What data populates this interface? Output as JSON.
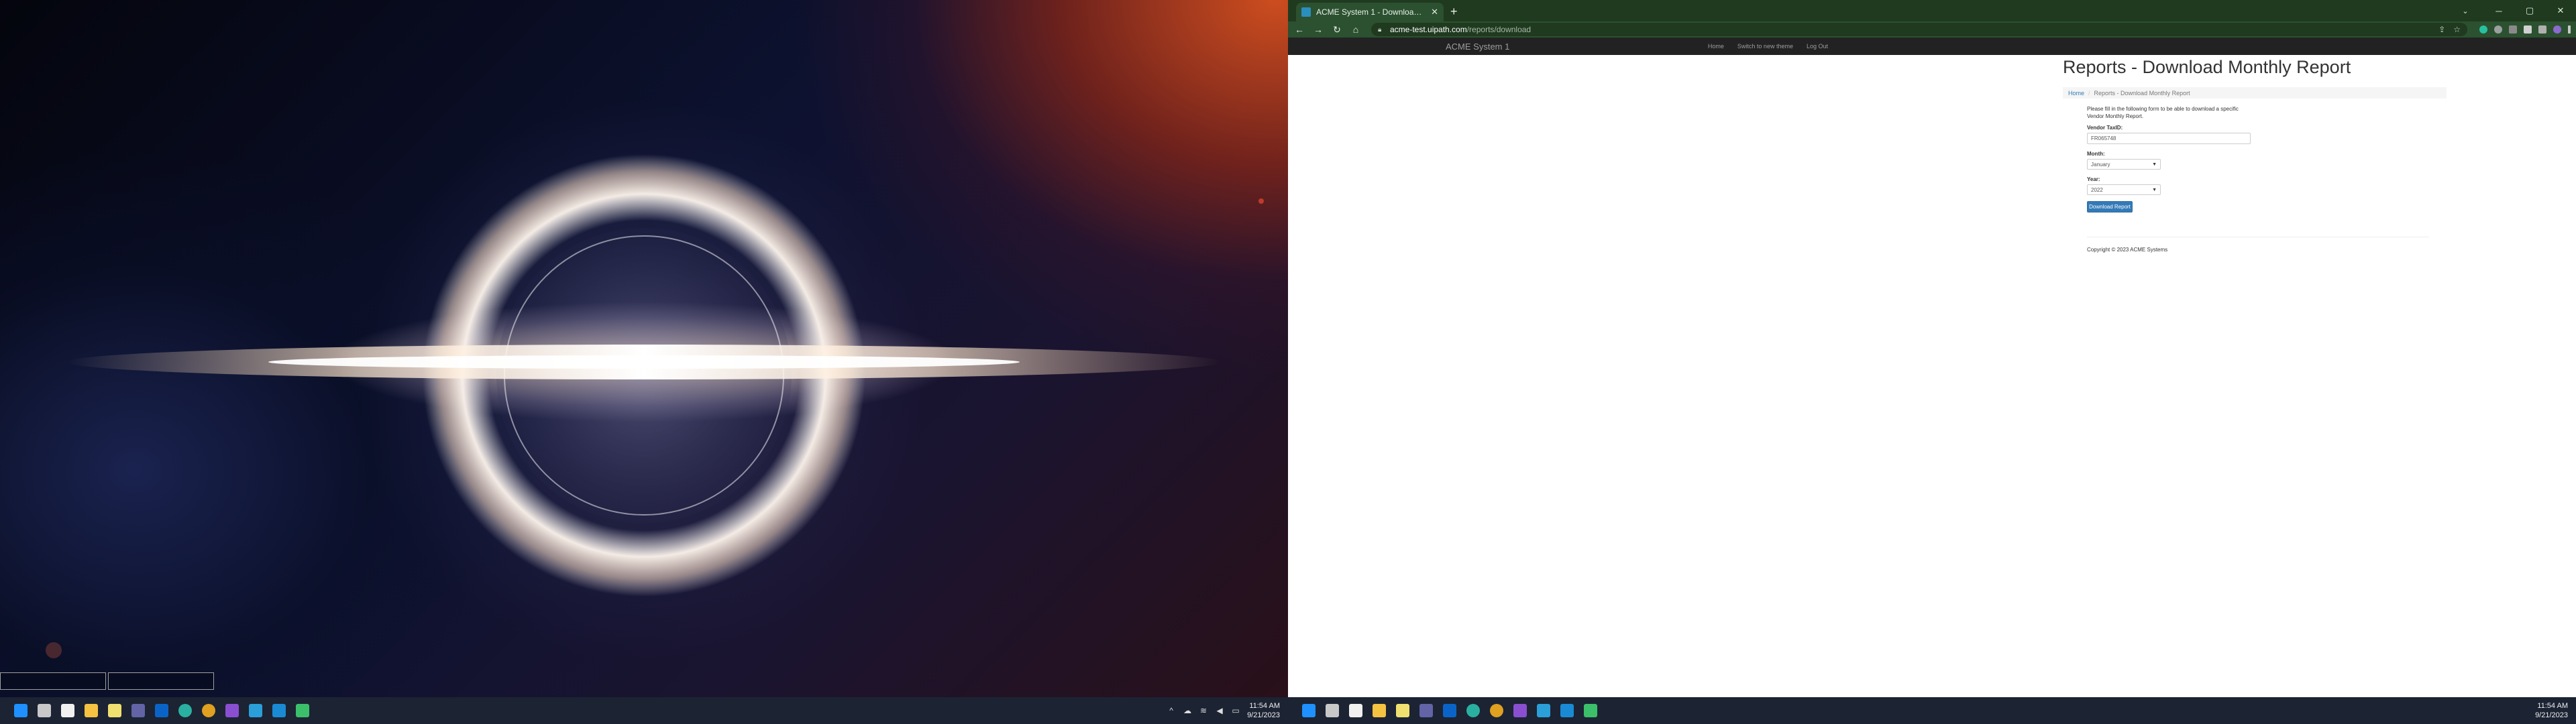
{
  "left_screen": {
    "wallpaper": "black-hole",
    "taskbar": {
      "icons": [
        "windows-start",
        "file-explorer-small",
        "calendar",
        "file-explorer",
        "notepad",
        "teams",
        "outlook",
        "edge-canary",
        "chrome",
        "visual-studio",
        "uipath-studio",
        "vscode",
        "uipath-assistant"
      ],
      "tray_time": "11:54 AM",
      "tray_date": "9/21/2023"
    }
  },
  "browser": {
    "tab": {
      "title": "ACME System 1 - Download M..."
    },
    "url": {
      "host": "acme-test.uipath.com",
      "path": "/reports/download"
    },
    "window_controls": {
      "minimize": "─",
      "maximize": "▢",
      "close": "✕"
    }
  },
  "site": {
    "brand": "ACME System 1",
    "nav": {
      "home": "Home",
      "theme": "Switch to new theme",
      "logout": "Log Out"
    },
    "page_title": "Reports - Download Monthly Report",
    "breadcrumb": {
      "home": "Home",
      "current": "Reports - Download Monthly Report"
    },
    "form": {
      "intro": "Please fill in the following form to be able to download a specific Vendor Monthly Report.",
      "vendor_label": "Vendor TaxID:",
      "vendor_value": "FR065748",
      "month_label": "Month:",
      "month_value": "January",
      "year_label": "Year:",
      "year_value": "2022",
      "submit": "Download Report"
    },
    "copyright": "Copyright © 2023 ACME Systems"
  },
  "right_screen": {
    "taskbar": {
      "icons": [
        "windows-start",
        "file-explorer-small",
        "calendar",
        "file-explorer",
        "notepad",
        "teams",
        "outlook",
        "edge-canary",
        "chrome",
        "visual-studio",
        "uipath-studio",
        "vscode",
        "uipath-assistant"
      ],
      "tray_time": "11:54 AM",
      "tray_date": "9/21/2023"
    }
  },
  "colors": {
    "chrome_frame": "#1f3a1f",
    "chrome_toolbar": "#2c5130",
    "navbar": "#222222",
    "primary": "#337ab7",
    "taskbar": "#1c2333"
  }
}
